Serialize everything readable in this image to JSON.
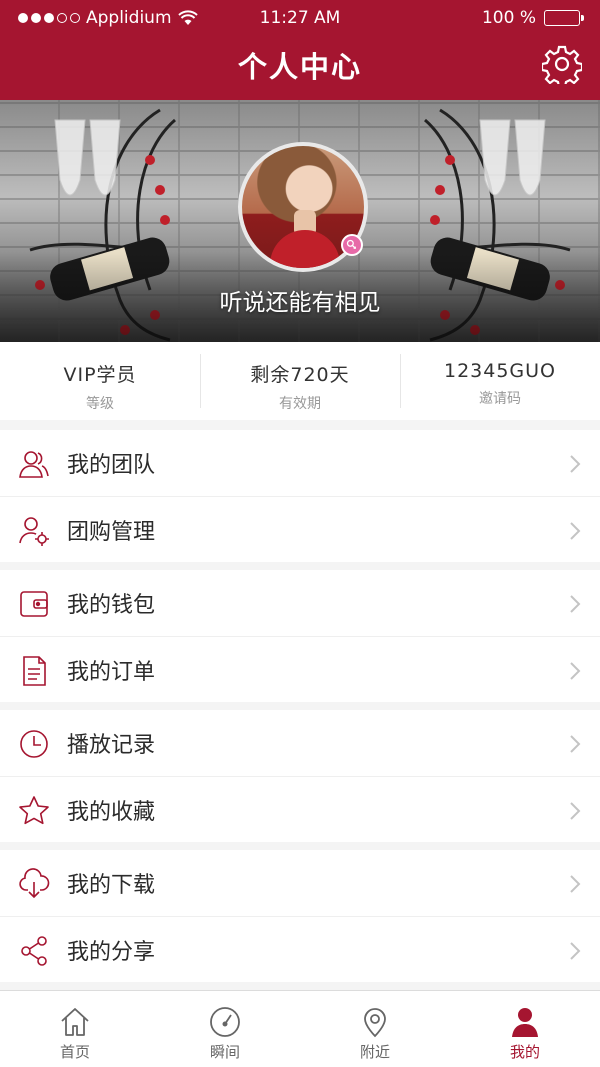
{
  "status_bar": {
    "carrier": "Applidium",
    "time": "11:27 AM",
    "battery": "100 %"
  },
  "header": {
    "title": "个人中心"
  },
  "profile": {
    "nickname": "听说还能有相见"
  },
  "stats": [
    {
      "value": "VIP学员",
      "label": "等级"
    },
    {
      "value": "剩余720天",
      "label": "有效期"
    },
    {
      "value": "12345GUO",
      "label": "邀请码"
    }
  ],
  "menu": {
    "groups": [
      [
        {
          "label": "我的团队",
          "icon": "team-icon"
        },
        {
          "label": "团购管理",
          "icon": "group-buy-manage-icon"
        }
      ],
      [
        {
          "label": "我的钱包",
          "icon": "wallet-icon"
        },
        {
          "label": "我的订单",
          "icon": "order-icon"
        }
      ],
      [
        {
          "label": "播放记录",
          "icon": "clock-icon"
        },
        {
          "label": "我的收藏",
          "icon": "star-icon"
        }
      ],
      [
        {
          "label": "我的下载",
          "icon": "cloud-download-icon"
        },
        {
          "label": "我的分享",
          "icon": "share-icon"
        }
      ]
    ]
  },
  "tabs": [
    {
      "label": "首页",
      "icon": "home-icon"
    },
    {
      "label": "瞬间",
      "icon": "speedometer-icon"
    },
    {
      "label": "附近",
      "icon": "location-pin-icon"
    },
    {
      "label": "我的",
      "icon": "person-icon",
      "active": true
    }
  ],
  "colors": {
    "brand": "#a51530",
    "text": "#2b2b2b",
    "muted": "#999999"
  }
}
